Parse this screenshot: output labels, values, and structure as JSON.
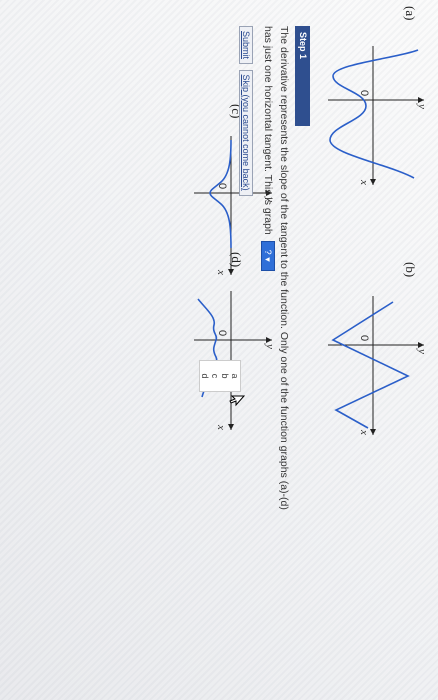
{
  "graphs": [
    {
      "label": "(a)",
      "y_label": "y",
      "x_label": "x",
      "origin_label": "0"
    },
    {
      "label": "(b)",
      "y_label": "y",
      "x_label": "x",
      "origin_label": "0"
    },
    {
      "label": "(c)",
      "y_label": "y",
      "x_label": "x",
      "origin_label": "0"
    },
    {
      "label": "(d)",
      "y_label": "y",
      "x_label": "x",
      "origin_label": "0"
    }
  ],
  "step": {
    "title": "Step 1",
    "line1": "The derivative represents the slope of the tangent to the function. Only one of the function graphs (a)-(d)",
    "line2": "has just one horizontal tangent. This is graph",
    "select_value": "?",
    "options": [
      "?",
      "a",
      "b",
      "c",
      "d"
    ]
  },
  "buttons": {
    "submit": "Submit",
    "skip": "Skip (you cannot come back)"
  },
  "colors": {
    "curve": "#2b5fc9",
    "axis": "#222222",
    "step_bar": "#2f4f8f",
    "select": "#2f6fd8"
  }
}
